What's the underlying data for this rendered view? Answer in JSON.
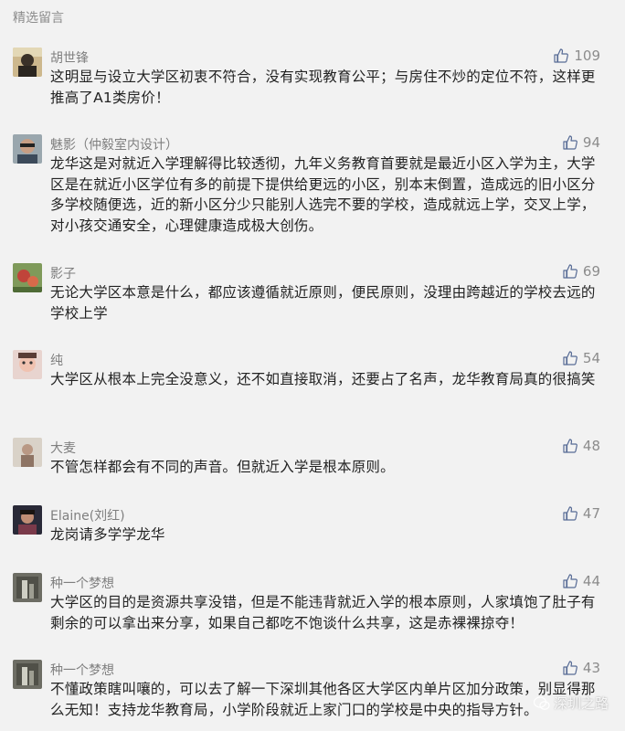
{
  "section_title": "精选留言",
  "comments": [
    {
      "nick": "胡世锋",
      "likes": "109",
      "text": "这明显与设立大学区初衷不符合，没有实现教育公平；与房住不炒的定位不符，这样更推高了A1类房价！"
    },
    {
      "nick": "魅影（仲毅室内设计）",
      "likes": "94",
      "text": "龙华这是对就近入学理解得比较透彻，九年义务教育首要就是最近小区入学为主，大学区是在就近小区学位有多的前提下提供给更远的小区，别本末倒置，造成远的旧小区分多学校随便选，近的新小区分少只能别人选完不要的学校，造成就远上学，交叉上学，对小孩交通安全，心理健康造成极大创伤。"
    },
    {
      "nick": "影子",
      "likes": "69",
      "text": "无论大学区本意是什么，都应该遵循就近原则，便民原则，没理由跨越近的学校去远的学校上学"
    },
    {
      "nick": "纯",
      "likes": "54",
      "text": "大学区从根本上完全没意义，还不如直接取消，还要占了名声，龙华教育局真的很搞笑"
    },
    {
      "nick": "大麦",
      "likes": "48",
      "text": "不管怎样都会有不同的声音。但就近入学是根本原则。"
    },
    {
      "nick": "Elaine(刘红)",
      "likes": "47",
      "text": "龙岗请多学学龙华"
    },
    {
      "nick": "种一个梦想",
      "likes": "44",
      "text": "大学区的目的是资源共享没错，但是不能违背就近入学的根本原则，人家填饱了肚子有剩余的可以拿出来分享，如果自己都吃不饱谈什么共享，这是赤裸裸掠夺！"
    },
    {
      "nick": "种一个梦想",
      "likes": "43",
      "text": "不懂政策瞎叫嚷的，可以去了解一下深圳其他各区大学区内单片区加分政策，别显得那么无知！支持龙华教育局，小学阶段就近上家门口的学校是中央的指导方针。"
    }
  ],
  "watermark": "深圳之路",
  "colors": {
    "background": "#f2f2f2",
    "meta_text": "#8c8c8c",
    "body_text": "#222222"
  },
  "icons": {
    "like": "thumbs-up-icon",
    "watermark": "wechat-icon"
  }
}
